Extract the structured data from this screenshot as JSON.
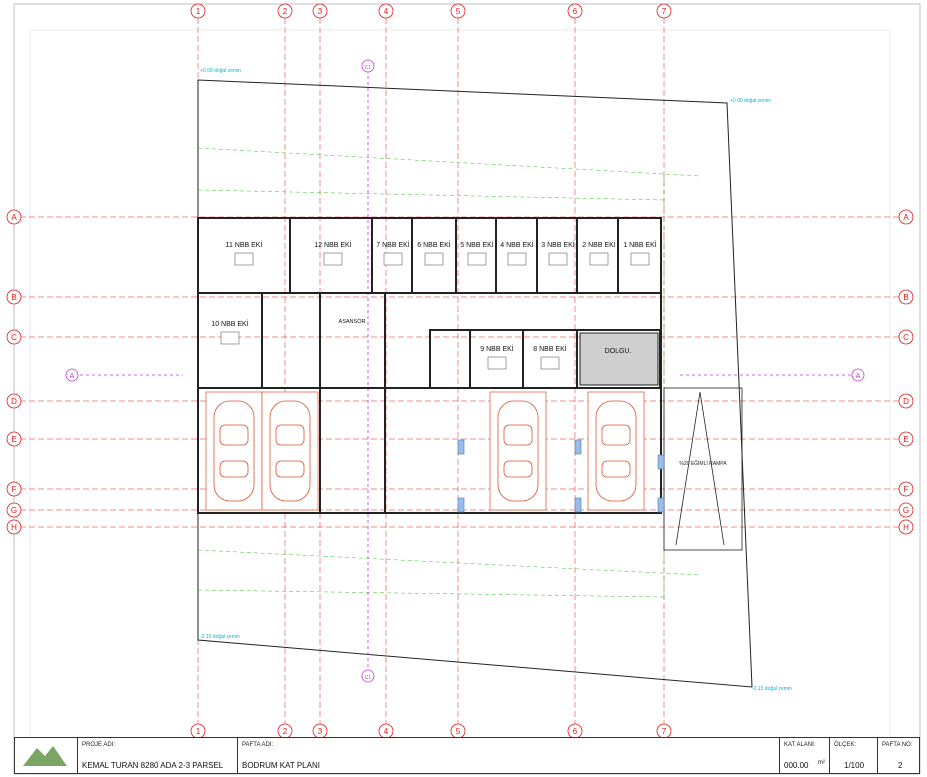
{
  "drawing": {
    "grid_columns": [
      "1",
      "2",
      "3",
      "4",
      "5",
      "6",
      "7"
    ],
    "grid_rows": [
      "A",
      "B",
      "C",
      "D",
      "E",
      "F",
      "G",
      "H"
    ],
    "section_markers": [
      "A",
      "A",
      "C1",
      "C1"
    ],
    "rooms": [
      {
        "label": "11 NBB EKİ"
      },
      {
        "label": "12 NBB EKİ"
      },
      {
        "label": "7 NBB EKİ"
      },
      {
        "label": "6 NBB EKİ"
      },
      {
        "label": "5 NBB EKİ"
      },
      {
        "label": "4 NBB EKİ"
      },
      {
        "label": "3 NBB EKİ"
      },
      {
        "label": "2 NBB EKİ"
      },
      {
        "label": "1 NBB EKİ"
      },
      {
        "label": "10 NBB EKİ"
      },
      {
        "label": "9 NBB EKİ"
      },
      {
        "label": "8 NBB EKİ"
      }
    ],
    "asansor": "ASANSÖR",
    "dolgu": "DOLGU.",
    "ramp": "%20 EĞİMLİ RAMPA",
    "elevations": [
      "+0.00 doğal zemin",
      "+0.00 doğal zemin",
      "-2.10 doğal zemin",
      "-2.15 doğal zemin"
    ],
    "colors": {
      "grid": "#e21a1a",
      "wall": "#222",
      "green": "#1faa1a",
      "blue": "#5b8fd8",
      "cyan": "#00b7d9",
      "magenta": "#c13ad6",
      "car": "#e0532b"
    }
  },
  "title_block": {
    "proje_adi_label": "PROJE ADI:",
    "proje_adi": "KEMAL TURAN 8280 ADA 2-3 PARSEL",
    "pafta_adi_label": "PAFTA ADI:",
    "pafta_adi": "BODRUM KAT PLANI",
    "kat_alani_label": "KAT ALANI:",
    "kat_alani": "000.00",
    "kat_alani_unit": "m²",
    "olcek_label": "ÖLÇEK:",
    "olcek": "1/100",
    "pafta_no_label": "PAFTA NO:",
    "pafta_no": "2"
  }
}
